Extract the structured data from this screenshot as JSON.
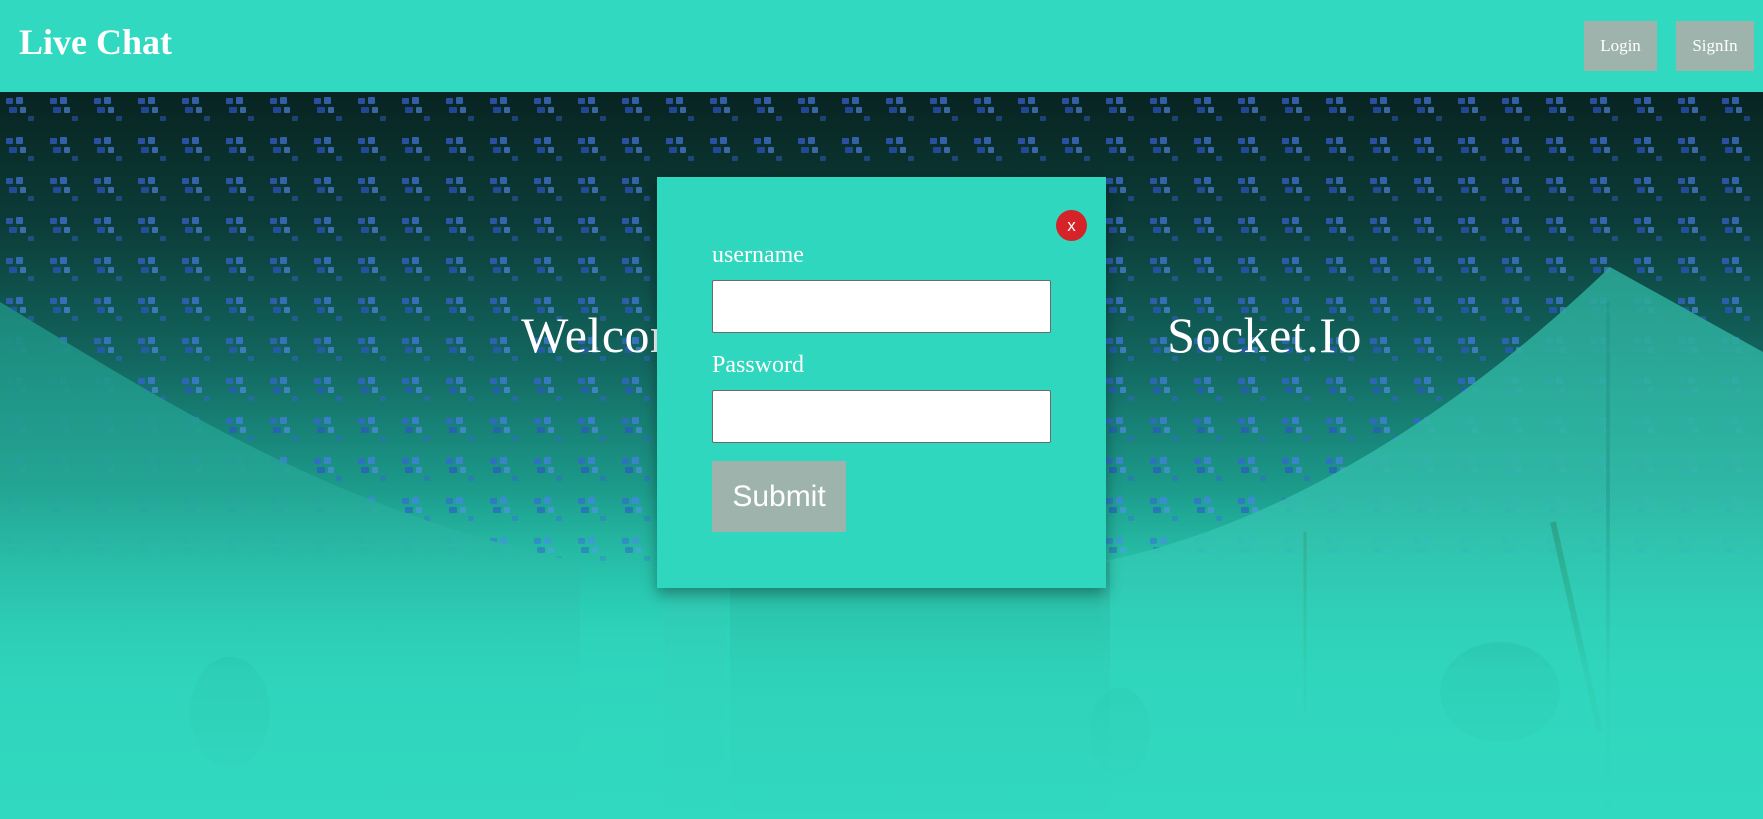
{
  "header": {
    "brand": "Live Chat",
    "login_label": "Login",
    "signin_label": "SignIn"
  },
  "hero": {
    "title_left": "Welcome",
    "title_right": "Socket.Io"
  },
  "modal": {
    "close_label": "x",
    "username_label": "username",
    "username_value": "",
    "password_label": "Password",
    "password_value": "",
    "submit_label": "Submit"
  },
  "colors": {
    "header_bg": "#31d9c0",
    "button_bg": "#9fb3ad",
    "close_bg": "#d6232a",
    "modal_bg": "#2ed7bd"
  }
}
